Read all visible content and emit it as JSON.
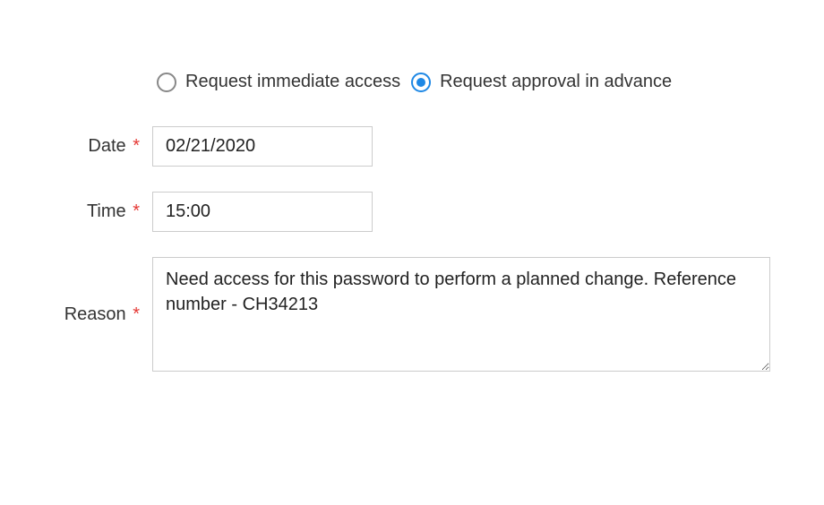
{
  "radios": {
    "immediate": {
      "label": "Request immediate access",
      "checked": false
    },
    "advance": {
      "label": "Request approval in advance",
      "checked": true
    }
  },
  "fields": {
    "date": {
      "label": "Date",
      "required_mark": "*",
      "value": "02/21/2020"
    },
    "time": {
      "label": "Time",
      "required_mark": "*",
      "value": "15:00"
    },
    "reason": {
      "label": "Reason",
      "required_mark": "*",
      "value": "Need access for this password to perform a planned change. Reference number - CH34213"
    }
  }
}
